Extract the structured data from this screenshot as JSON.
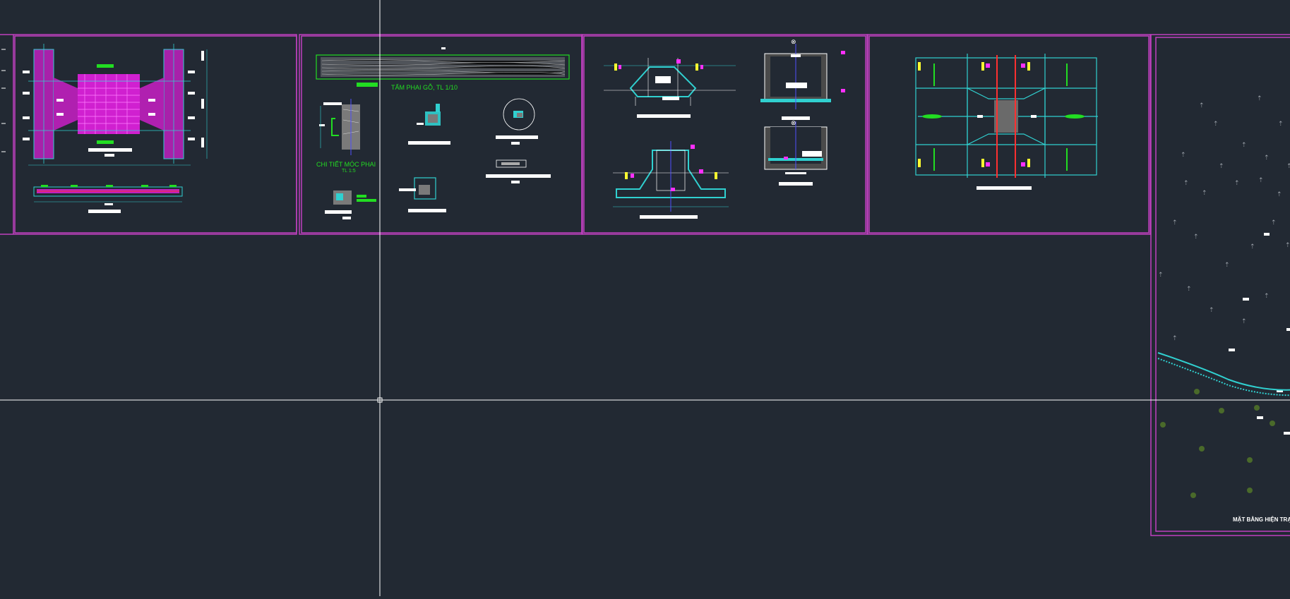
{
  "canvas": {
    "background": "#222933",
    "sheet_border_color": "#c040c0",
    "cyan_color": "#30d0d0",
    "green_color": "#22dd22",
    "magenta_color": "#ff30ff",
    "yellow_color": "#ffff30",
    "red_color": "#ff3030"
  },
  "labels": {
    "wood_panel_title": "TẤM PHAI GỖ, TL 1/10",
    "hook_detail_title": "CHI TIẾT MÓC PHAI",
    "hook_detail_scale": "TL 1:5",
    "site_plan_title": "MẶT BẰNG HIỆN TRẠ"
  },
  "icons": [
    "crosshair-cursor",
    "section-arrow-icon",
    "tree-symbol-icon"
  ]
}
